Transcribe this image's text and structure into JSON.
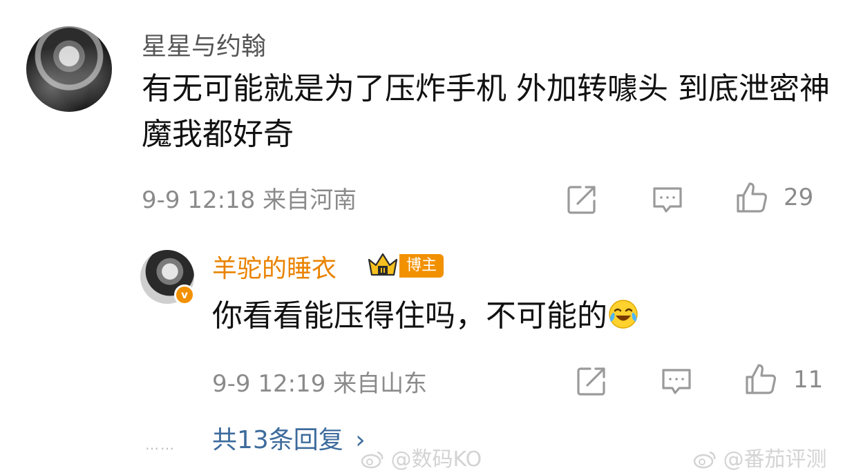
{
  "comment": {
    "username": "星星与约翰",
    "content": "有无可能就是为了压炸手机 外加转噱头  到底泄密神魔我都好奇",
    "time_location": "9-9 12:18  来自河南",
    "actions": {
      "share_icon": "share-icon",
      "comment_icon": "comment-icon",
      "like_icon": "thumbs-up-icon",
      "like_count": "29"
    }
  },
  "reply": {
    "username": "羊驼的睡衣",
    "badge_label": "博主",
    "vip_mark": "v",
    "content": "你看看能压得住吗，不可能的",
    "emoji": "laughing-crying-emoji",
    "time_location": "9-9 12:19  来自山东",
    "actions": {
      "share_icon": "share-icon",
      "comment_icon": "comment-icon",
      "like_icon": "thumbs-up-icon",
      "like_count": "11"
    }
  },
  "footer": {
    "dots": "……",
    "replies_link": "共13条回复",
    "chevron": "›"
  },
  "watermarks": [
    "@数码KO",
    "@番茄评测"
  ],
  "colors": {
    "accent_orange": "#f29100",
    "link_blue": "#3d6b9c",
    "meta_gray": "#8a8a8a"
  }
}
